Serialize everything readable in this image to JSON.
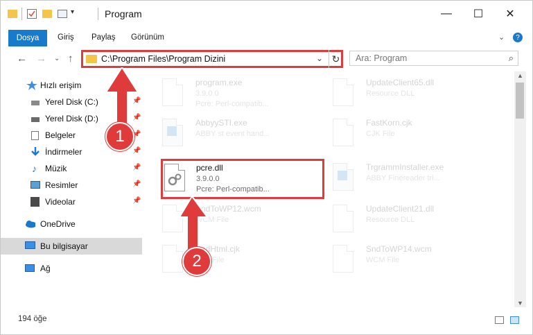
{
  "window": {
    "title": "Program",
    "controls": {
      "minimize": "—",
      "maximize": "☐",
      "close": "✕"
    }
  },
  "ribbon": {
    "tabs": [
      "Dosya",
      "Giriş",
      "Paylaş",
      "Görünüm"
    ],
    "help": "?"
  },
  "address_bar": {
    "path": "C:\\Program Files\\Program Dizini",
    "search_placeholder": "Ara: Program"
  },
  "sidebar": {
    "items": [
      {
        "label": "Hızlı erişim",
        "icon": "star-icon"
      },
      {
        "label": "Yerel Disk (C:)",
        "icon": "drive-icon",
        "pinned": true
      },
      {
        "label": "Yerel Disk (D:)",
        "icon": "drive-icon",
        "pinned": true
      },
      {
        "label": "Belgeler",
        "icon": "documents-icon",
        "pinned": true
      },
      {
        "label": "İndirmeler",
        "icon": "download-icon",
        "pinned": true
      },
      {
        "label": "Müzik",
        "icon": "music-icon",
        "pinned": true
      },
      {
        "label": "Resimler",
        "icon": "pictures-icon",
        "pinned": true
      },
      {
        "label": "Videolar",
        "icon": "videos-icon",
        "pinned": true
      },
      {
        "label": "OneDrive",
        "icon": "cloud-icon"
      },
      {
        "label": "Bu bilgisayar",
        "icon": "computer-icon",
        "selected": true
      },
      {
        "label": "Ağ",
        "icon": "network-icon"
      }
    ]
  },
  "files": {
    "left_column": [
      {
        "name": "program.exe",
        "line2": "3.9.0.0",
        "line3": "Pcre: Perl-compatib..."
      },
      {
        "name": "AbbyySTI.exe",
        "line2": "ABBY st event hand..."
      },
      {
        "name": "pcre.dll",
        "line2": "3.9.0.0",
        "line3": "Pcre: Perl-compatib...",
        "highlighted": true
      },
      {
        "name": "SndToWP12.wcm",
        "line2": "WCM File"
      },
      {
        "name": "SndHtml.cjk",
        "line2": "CJK File"
      }
    ],
    "right_column": [
      {
        "name": "UpdateClient65.dll",
        "line2": "Resource DLL"
      },
      {
        "name": "FastKorn.cjk",
        "line2": "CJK File"
      },
      {
        "name": "TrgrammInstaller.exe",
        "line2": "ABBY Finereader tri..."
      },
      {
        "name": "UpdateClient21.dll",
        "line2": "Resource DLL"
      },
      {
        "name": "SndToWP14.wcm",
        "line2": "WCM File"
      }
    ]
  },
  "status_bar": {
    "item_count": "194 öğe"
  },
  "annotations": {
    "step1": "1",
    "step2": "2",
    "accent_color": "#e03b3b"
  }
}
